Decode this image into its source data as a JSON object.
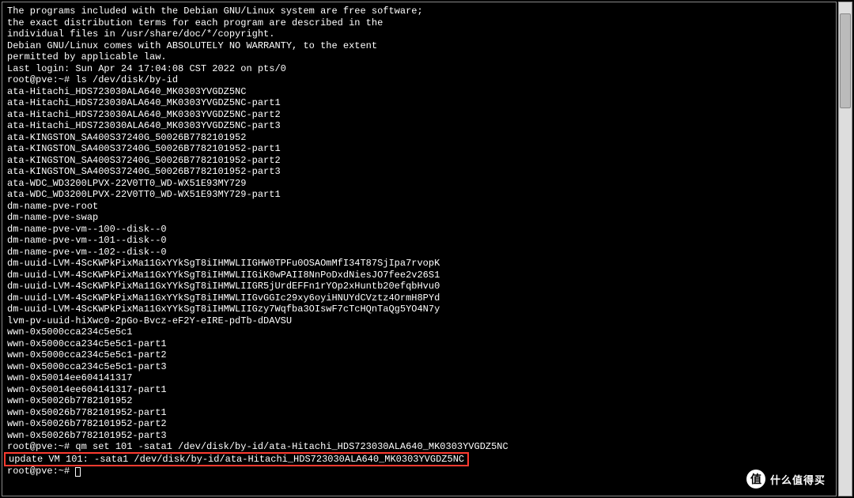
{
  "terminal": {
    "motd_lines": [
      "The programs included with the Debian GNU/Linux system are free software;",
      "the exact distribution terms for each program are described in the",
      "individual files in /usr/share/doc/*/copyright.",
      "",
      "Debian GNU/Linux comes with ABSOLUTELY NO WARRANTY, to the extent",
      "permitted by applicable law."
    ],
    "last_login": "Last login: Sun Apr 24 17:04:08 CST 2022 on pts/0",
    "prompt1": "root@pve:~# ",
    "command1": "ls /dev/disk/by-id",
    "ls_output": [
      "ata-Hitachi_HDS723030ALA640_MK0303YVGDZ5NC",
      "ata-Hitachi_HDS723030ALA640_MK0303YVGDZ5NC-part1",
      "ata-Hitachi_HDS723030ALA640_MK0303YVGDZ5NC-part2",
      "ata-Hitachi_HDS723030ALA640_MK0303YVGDZ5NC-part3",
      "ata-KINGSTON_SA400S37240G_50026B7782101952",
      "ata-KINGSTON_SA400S37240G_50026B7782101952-part1",
      "ata-KINGSTON_SA400S37240G_50026B7782101952-part2",
      "ata-KINGSTON_SA400S37240G_50026B7782101952-part3",
      "ata-WDC_WD3200LPVX-22V0TT0_WD-WX51E93MY729",
      "ata-WDC_WD3200LPVX-22V0TT0_WD-WX51E93MY729-part1",
      "dm-name-pve-root",
      "dm-name-pve-swap",
      "dm-name-pve-vm--100--disk--0",
      "dm-name-pve-vm--101--disk--0",
      "dm-name-pve-vm--102--disk--0",
      "dm-uuid-LVM-4ScKWPkPixMa11GxYYkSgT8iIHMWLIIGHW0TPFu0OSAOmMfI34T87SjIpa7rvopK",
      "dm-uuid-LVM-4ScKWPkPixMa11GxYYkSgT8iIHMWLIIGiK0wPAII8NnPoDxdNiesJO7fee2v26S1",
      "dm-uuid-LVM-4ScKWPkPixMa11GxYYkSgT8iIHMWLIIGR5jUrdEFFn1rYOp2xHuntb20efqbHvu0",
      "dm-uuid-LVM-4ScKWPkPixMa11GxYYkSgT8iIHMWLIIGvGGIc29xy6oyiHNUYdCVztz4OrmH8PYd",
      "dm-uuid-LVM-4ScKWPkPixMa11GxYYkSgT8iIHMWLIIGzy7Wqfba3OIswF7cTcHQnTaQg5YO4N7y",
      "lvm-pv-uuid-hiXwc0-2pGo-Bvcz-eF2Y-eIRE-pdTb-dDAVSU",
      "wwn-0x5000cca234c5e5c1",
      "wwn-0x5000cca234c5e5c1-part1",
      "wwn-0x5000cca234c5e5c1-part2",
      "wwn-0x5000cca234c5e5c1-part3",
      "wwn-0x50014ee604141317",
      "wwn-0x50014ee604141317-part1",
      "wwn-0x50026b7782101952",
      "wwn-0x50026b7782101952-part1",
      "wwn-0x50026b7782101952-part2",
      "wwn-0x50026b7782101952-part3"
    ],
    "prompt2": "root@pve:~# ",
    "command2": "qm set 101 -sata1 /dev/disk/by-id/ata-Hitachi_HDS723030ALA640_MK0303YVGDZ5NC",
    "highlighted_output": "update VM 101: -sata1 /dev/disk/by-id/ata-Hitachi_HDS723030ALA640_MK0303YVGDZ5NC",
    "prompt3": "root@pve:~# "
  },
  "watermark": {
    "icon_text": "值",
    "text": "什么值得买"
  }
}
